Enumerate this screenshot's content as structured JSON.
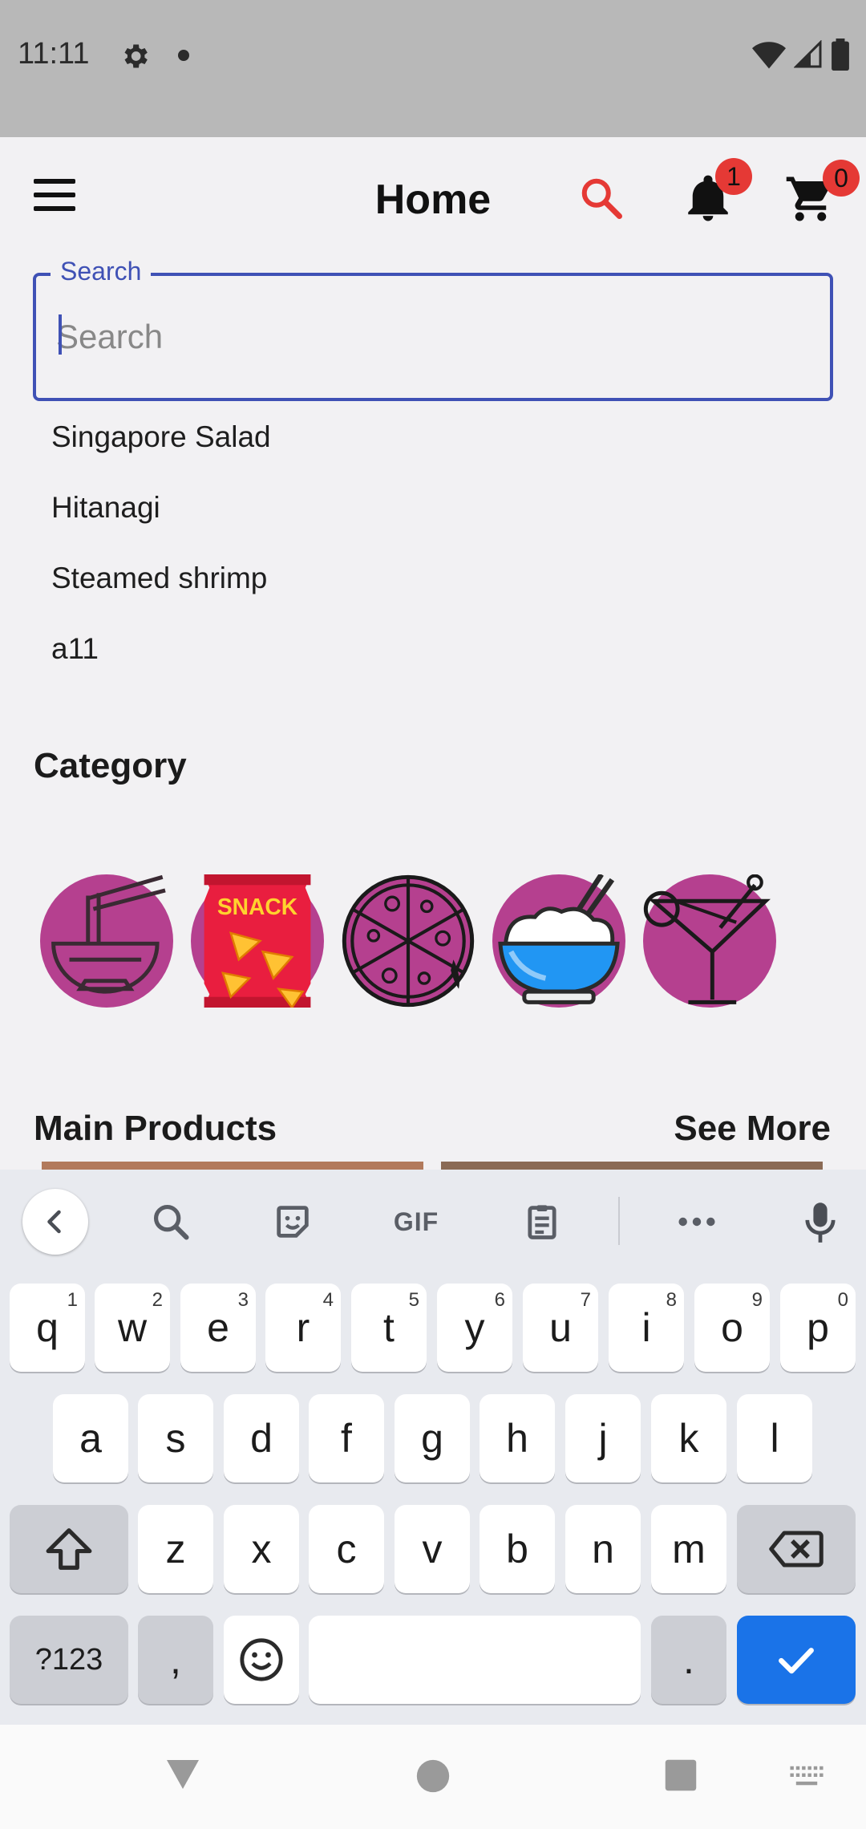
{
  "status_bar": {
    "time": "11:11"
  },
  "app_bar": {
    "title": "Home",
    "notification_count": "1",
    "cart_count": "0",
    "accent_color": "#e53935"
  },
  "search": {
    "label": "Search",
    "placeholder": "Search",
    "value": "",
    "focus_color": "#3f51b5"
  },
  "suggestions": [
    "Singapore Salad",
    "Hitanagi",
    "Steamed shrimp",
    "a11"
  ],
  "category": {
    "title": "Category",
    "items": [
      "noodles-icon",
      "snack-icon",
      "pizza-icon",
      "rice-bowl-icon",
      "cocktail-icon"
    ],
    "snack_label": "SNACK",
    "circle_color": "#b5408f"
  },
  "main_products": {
    "title": "Main Products",
    "see_more": "See More"
  },
  "keyboard": {
    "toolbar": {
      "gif": "GIF"
    },
    "row1": [
      {
        "k": "q",
        "h": "1"
      },
      {
        "k": "w",
        "h": "2"
      },
      {
        "k": "e",
        "h": "3"
      },
      {
        "k": "r",
        "h": "4"
      },
      {
        "k": "t",
        "h": "5"
      },
      {
        "k": "y",
        "h": "6"
      },
      {
        "k": "u",
        "h": "7"
      },
      {
        "k": "i",
        "h": "8"
      },
      {
        "k": "o",
        "h": "9"
      },
      {
        "k": "p",
        "h": "0"
      }
    ],
    "row2": [
      "a",
      "s",
      "d",
      "f",
      "g",
      "h",
      "j",
      "k",
      "l"
    ],
    "row3": [
      "z",
      "x",
      "c",
      "v",
      "b",
      "n",
      "m"
    ],
    "symbols": "?123",
    "comma": ",",
    "period": ".",
    "enter_color": "#1a73e8"
  }
}
